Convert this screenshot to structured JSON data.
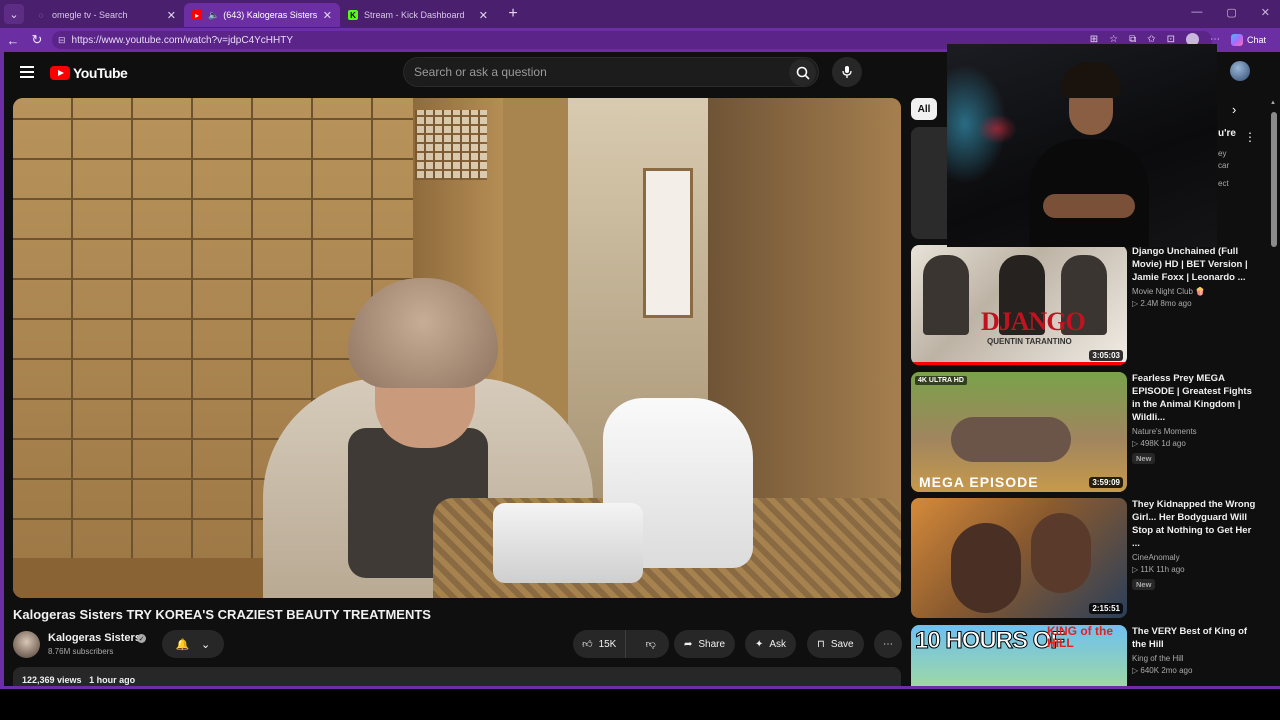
{
  "browser": {
    "tabs": [
      {
        "title": "omegle tv - Search",
        "active": false
      },
      {
        "title": "(643) Kalogeras Sisters TRY KOREA",
        "active": true
      },
      {
        "title": "Stream - Kick Dashboard",
        "active": false
      }
    ],
    "url": "https://www.youtube.com/watch?v=jdpC4YcHHTY",
    "chat_label": "Chat",
    "accent_color": "#6c2ea3"
  },
  "header": {
    "logo_text": "YouTube",
    "search_placeholder": "Search or ask a question"
  },
  "video": {
    "title": "Kalogeras Sisters TRY KOREA'S CRAZIEST BEAUTY TREATMENTS",
    "channel": "Kalogeras Sisters",
    "subscribers": "8.76M subscribers",
    "likes": "15K",
    "share_label": "Share",
    "ask_label": "Ask",
    "save_label": "Save",
    "views": "122,369 views",
    "posted": "1 hour ago"
  },
  "sidebar": {
    "chip_all": "All",
    "partial": {
      "title": "u're",
      "line1": "ey",
      "line2": "car",
      "line3": "ect"
    },
    "recommendations": [
      {
        "title": "Django Unchained (Full Movie) HD | BET Version | Jamie Foxx | Leonardo ...",
        "channel": "Movie Night Club 🍿",
        "views": "2.4M",
        "age": "8mo ago",
        "duration": "3:05:03",
        "badge": "",
        "thumb_text": "DJANGO",
        "thumb_subtext": "QUENTIN TARANTINO"
      },
      {
        "title": "Fearless Prey MEGA EPISODE | Greatest Fights in the Animal Kingdom | Wildli...",
        "channel": "Nature's Moments",
        "views": "498K",
        "age": "1d ago",
        "duration": "3:59:09",
        "badge": "New",
        "thumb_tag": "4K ULTRA HD",
        "thumb_text": "MEGA EPISODE"
      },
      {
        "title": "They Kidnapped the Wrong Girl... Her Bodyguard Will Stop at Nothing to Get Her ...",
        "channel": "CineAnomaly",
        "views": "11K",
        "age": "11h ago",
        "duration": "2:15:51",
        "badge": "New"
      },
      {
        "title": "The VERY Best of King of the Hill",
        "channel": "King of the Hill",
        "views": "640K",
        "age": "2mo ago",
        "duration": "",
        "badge": "",
        "thumb_text": "10 HOURS OF",
        "thumb_subtext": "KING of the HILL"
      }
    ]
  }
}
